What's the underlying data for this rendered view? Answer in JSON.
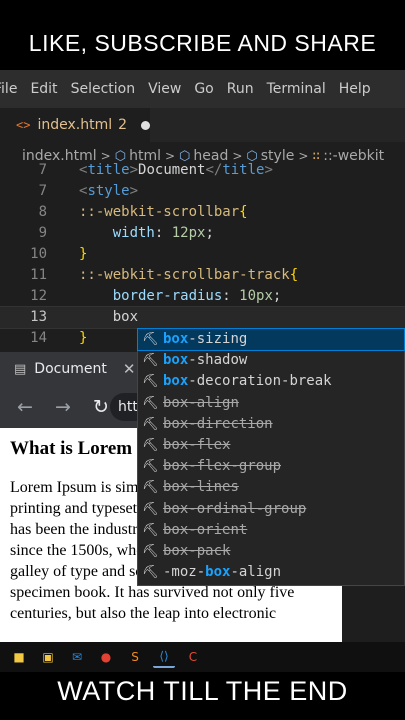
{
  "banner": {
    "top": "LIKE, SUBSCRIBE AND SHARE",
    "bottom": "WATCH TILL THE END"
  },
  "menu": [
    "File",
    "Edit",
    "Selection",
    "View",
    "Go",
    "Run",
    "Terminal",
    "Help"
  ],
  "tab": {
    "name": "index.html",
    "problems": "2",
    "icon": "html-file-icon"
  },
  "breadcrumb": [
    {
      "label": "index.html",
      "icon": ""
    },
    {
      "label": "html",
      "icon": "cube-icon"
    },
    {
      "label": "head",
      "icon": "cube-icon"
    },
    {
      "label": "style",
      "icon": "cube-icon"
    },
    {
      "label": "::-webkit",
      "icon": "symbol-icon"
    }
  ],
  "editor": {
    "current_line": 13,
    "lines": [
      {
        "n": "7",
        "tokens": [
          [
            "tag",
            "<"
          ],
          [
            "tagname",
            "title"
          ],
          [
            "tag",
            ">"
          ],
          [
            "txt",
            "Document"
          ],
          [
            "tag",
            "</"
          ],
          [
            "tagname",
            "title"
          ],
          [
            "tag",
            ">"
          ]
        ]
      },
      {
        "n": "7",
        "tokens": [
          [
            "tag",
            "<"
          ],
          [
            "tagname",
            "style"
          ],
          [
            "tag",
            ">"
          ]
        ]
      },
      {
        "n": "8",
        "tokens": [
          [
            "sel",
            "::-webkit-scrollbar"
          ],
          [
            "brace",
            "{"
          ]
        ]
      },
      {
        "n": "9",
        "tokens": [
          [
            "txt",
            "    "
          ],
          [
            "prop",
            "width"
          ],
          [
            "punct",
            ": "
          ],
          [
            "val",
            "12px"
          ],
          [
            "punct",
            ";"
          ]
        ]
      },
      {
        "n": "10",
        "tokens": [
          [
            "brace",
            "}"
          ]
        ]
      },
      {
        "n": "11",
        "tokens": [
          [
            "sel",
            "::-webkit-scrollbar-track"
          ],
          [
            "brace",
            "{"
          ]
        ]
      },
      {
        "n": "12",
        "tokens": [
          [
            "txt",
            "    "
          ],
          [
            "prop",
            "border-radius"
          ],
          [
            "punct",
            ": "
          ],
          [
            "val",
            "10px"
          ],
          [
            "punct",
            ";"
          ]
        ]
      },
      {
        "n": "13",
        "tokens": [
          [
            "txt",
            "    box"
          ]
        ]
      },
      {
        "n": "14",
        "tokens": [
          [
            "brace",
            "}"
          ]
        ]
      }
    ]
  },
  "browser": {
    "tab_title": "Document",
    "url_text": "http",
    "page_heading": "What is Lorem",
    "page_paragraph": "Lorem Ipsum is simply dummy text of the printing and typesetting industry. Lorem Ipsum has been the industry's standard dummy text ever since the 1500s, when an unknown printer took a galley of type and scrambled it to make a type specimen book. It has survived not only five centuries, but also the leap into electronic"
  },
  "suggestions": [
    {
      "match": "box",
      "rest": "-sizing",
      "prefix": "",
      "deprecated": false,
      "active": true
    },
    {
      "match": "box",
      "rest": "-shadow",
      "prefix": "",
      "deprecated": false,
      "active": false
    },
    {
      "match": "box",
      "rest": "-decoration-break",
      "prefix": "",
      "deprecated": false,
      "active": false
    },
    {
      "match": "box",
      "rest": "-align",
      "prefix": "",
      "deprecated": true,
      "active": false
    },
    {
      "match": "box",
      "rest": "-direction",
      "prefix": "",
      "deprecated": true,
      "active": false
    },
    {
      "match": "box",
      "rest": "-flex",
      "prefix": "",
      "deprecated": true,
      "active": false
    },
    {
      "match": "box",
      "rest": "-flex-group",
      "prefix": "",
      "deprecated": true,
      "active": false
    },
    {
      "match": "box",
      "rest": "-lines",
      "prefix": "",
      "deprecated": true,
      "active": false
    },
    {
      "match": "box",
      "rest": "-ordinal-group",
      "prefix": "",
      "deprecated": true,
      "active": false
    },
    {
      "match": "box",
      "rest": "-orient",
      "prefix": "",
      "deprecated": true,
      "active": false
    },
    {
      "match": "box",
      "rest": "-pack",
      "prefix": "",
      "deprecated": true,
      "active": false
    },
    {
      "match": "box",
      "rest": "-align",
      "prefix": "-moz-",
      "deprecated": false,
      "active": false
    }
  ],
  "taskbar": [
    {
      "icon": "file-explorer-icon",
      "color": "#f2c744"
    },
    {
      "icon": "store-icon",
      "color": "#f2c744"
    },
    {
      "icon": "mail-icon",
      "color": "#2b88d8"
    },
    {
      "icon": "chrome-icon",
      "color": "#e34133"
    },
    {
      "icon": "sublime-icon",
      "color": "#f08a24"
    },
    {
      "icon": "vscode-icon",
      "color": "#2f8bd8",
      "active": true
    },
    {
      "icon": "app-icon",
      "color": "#e14c3b"
    }
  ]
}
